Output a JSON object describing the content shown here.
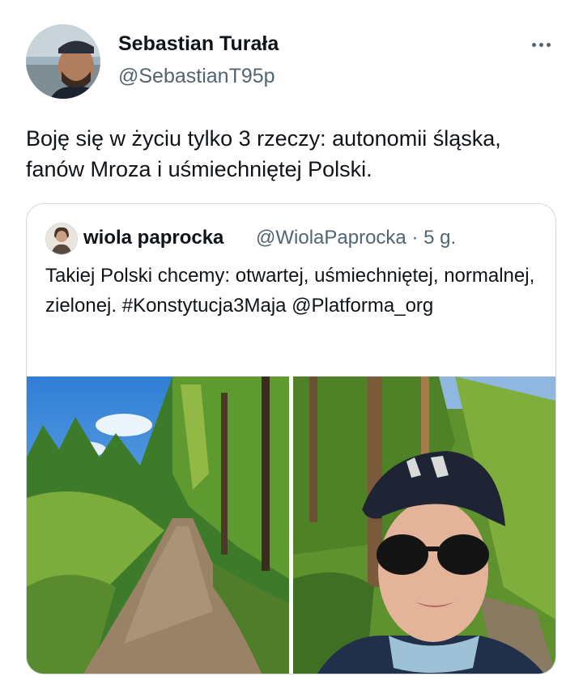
{
  "author": {
    "name": "Sebastian Turała",
    "handle": "@SebastianT95p"
  },
  "tweet": {
    "text": "Boję się w życiu tylko 3 rzeczy: autonomii śląska, fanów Mroza i uśmiechniętej Polski."
  },
  "quoted_tweet": {
    "name": "wiola paprocka",
    "handle": "@WiolaPaprocka",
    "separator": "·",
    "time": "5 g.",
    "text": "Takiej Polski chcemy: otwartej, uśmiechniętej, normalnej, zielonej. #Konstytucja3Maja @Platforma_org"
  },
  "icons": {
    "more": "more-horizontal-icon"
  },
  "colors": {
    "text": "#0f1419",
    "secondary": "#536471",
    "border": "#cfd9de"
  }
}
